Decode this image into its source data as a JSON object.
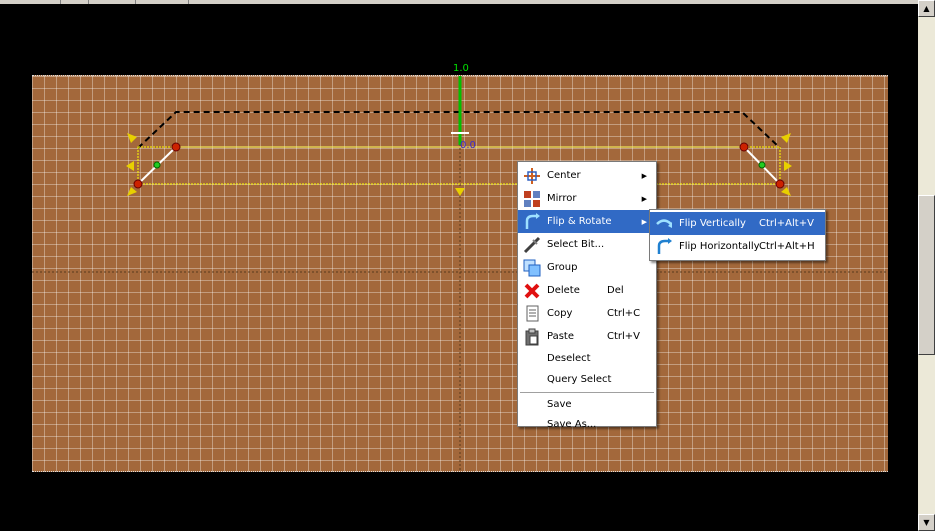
{
  "axis": {
    "y_label": "1.0",
    "origin_label": "0.0"
  },
  "context_menu": {
    "items": [
      {
        "label": "Center",
        "shortcut": "",
        "submenu": true,
        "icon": "center-icon"
      },
      {
        "label": "Mirror",
        "shortcut": "",
        "submenu": true,
        "icon": "mirror-icon"
      },
      {
        "label": "Flip & Rotate",
        "shortcut": "",
        "submenu": true,
        "icon": "flip-rotate-icon",
        "highlighted": true
      },
      {
        "label": "Select Bit...",
        "shortcut": "",
        "icon": "select-bit-icon"
      },
      {
        "label": "Group",
        "shortcut": "",
        "icon": "group-icon"
      },
      {
        "label": "Delete",
        "shortcut": "Del",
        "icon": "delete-icon"
      },
      {
        "label": "Copy",
        "shortcut": "Ctrl+C",
        "icon": "copy-icon"
      },
      {
        "label": "Paste",
        "shortcut": "Ctrl+V",
        "icon": "paste-icon"
      },
      {
        "label": "Deselect",
        "shortcut": ""
      },
      {
        "label": "Query Select",
        "shortcut": ""
      },
      {
        "label": "Save",
        "shortcut": ""
      },
      {
        "label": "Save As...",
        "shortcut": ""
      }
    ]
  },
  "submenu": {
    "items": [
      {
        "label": "Flip Vertically",
        "shortcut": "Ctrl+Alt+V",
        "icon": "flip-vertical-icon",
        "highlighted": true
      },
      {
        "label": "Flip Horizontally",
        "shortcut": "Ctrl+Alt+H",
        "icon": "flip-horizontal-icon"
      }
    ]
  },
  "colors": {
    "workspace": "#a3683b",
    "menu_highlight": "#316ac5",
    "axis_green": "#00c000",
    "selection_yellow": "#ffff00"
  }
}
